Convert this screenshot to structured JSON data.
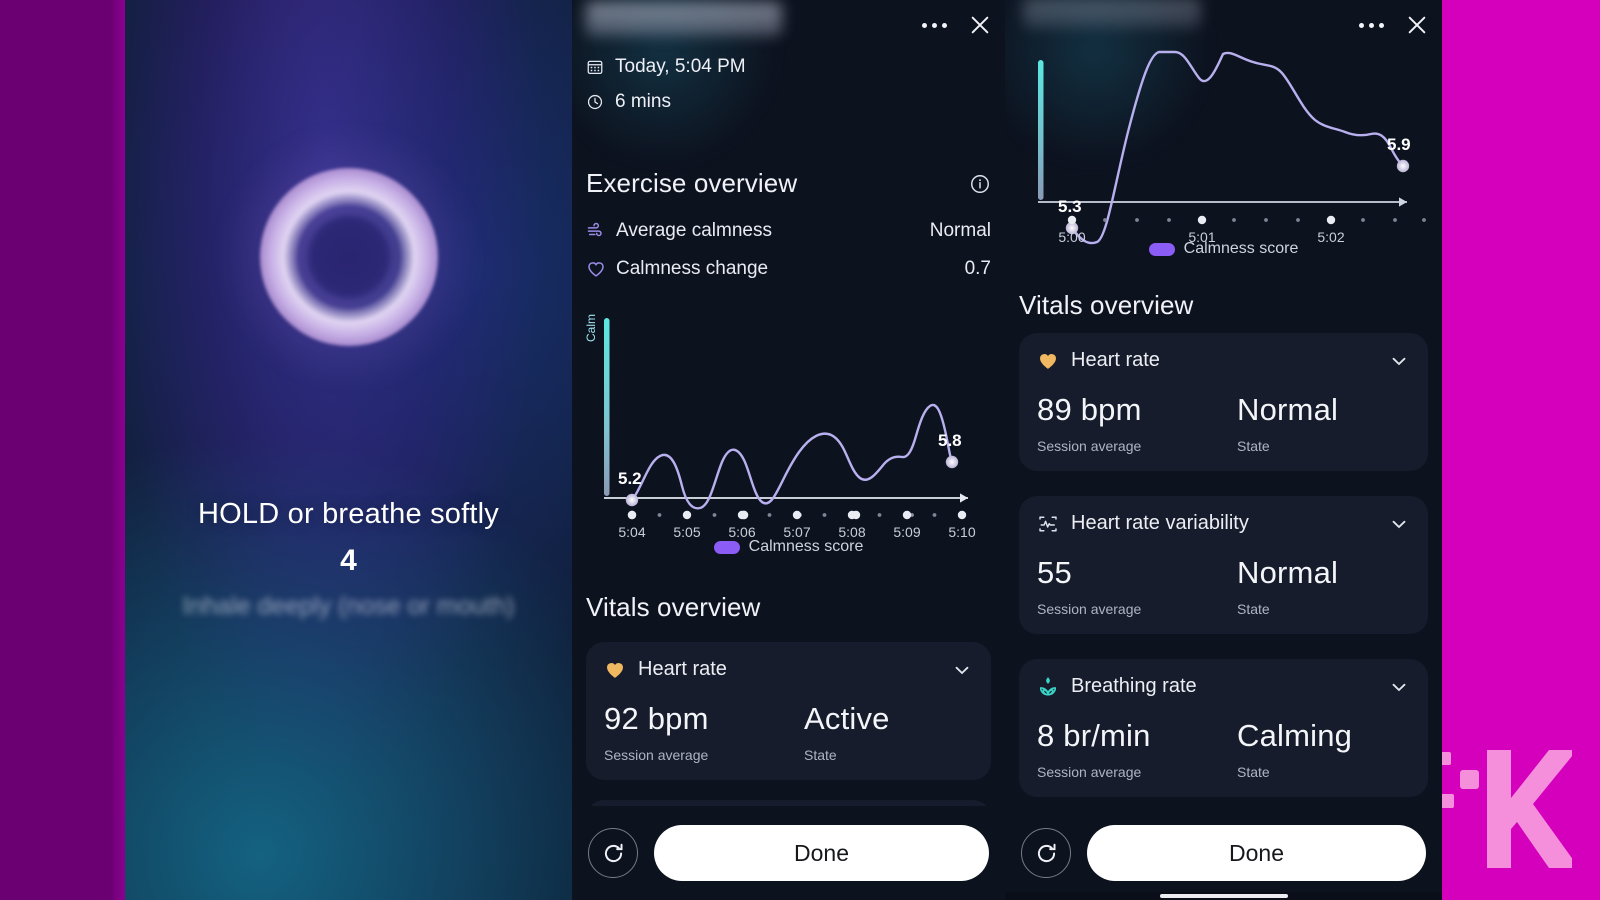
{
  "backdrop": {
    "left_band_color": "#6b0072",
    "right_color": "#d400bc",
    "watermark": "K"
  },
  "breathing_panel": {
    "name": "breathing-exercise",
    "instruction": "HOLD or breathe softly",
    "count": "4",
    "sub_instruction": "Inhale deeply (nose or mouth)",
    "ring_icon": "breathing-ring"
  },
  "middle_panel": {
    "header": {
      "title_redacted": "",
      "more_icon": "more-options-icon",
      "close_icon": "close-icon"
    },
    "meta": [
      {
        "icon": "calendar-icon",
        "text": "Today, 5:04 PM"
      },
      {
        "icon": "clock-icon",
        "text": "6 mins"
      }
    ],
    "exercise_overview": {
      "title": "Exercise overview",
      "info_icon": "info-icon",
      "rows": [
        {
          "icon": "wind-icon",
          "label": "Average calmness",
          "value": "Normal"
        },
        {
          "icon": "heart-outline-icon",
          "label": "Calmness change",
          "value": "0.7"
        }
      ]
    },
    "vitals_overview": {
      "title": "Vitals overview",
      "cards": [
        {
          "icon": "heart-filled-icon",
          "name": "Heart rate",
          "chevron": "chevron-down-icon",
          "value": "92 bpm",
          "value_label": "Session average",
          "state": "Active",
          "state_label": "State"
        }
      ]
    },
    "footer": {
      "refresh_icon": "refresh-icon",
      "done_label": "Done"
    }
  },
  "right_panel": {
    "header": {
      "title_redacted": "",
      "more_icon": "more-options-icon",
      "close_icon": "close-icon"
    },
    "vitals_overview": {
      "title": "Vitals overview",
      "cards": [
        {
          "icon": "heart-filled-icon",
          "name": "Heart rate",
          "chevron": "chevron-down-icon",
          "value": "89 bpm",
          "value_label": "Session average",
          "state": "Normal",
          "state_label": "State"
        },
        {
          "icon": "heart-rate-variability-icon",
          "name": "Heart rate variability",
          "chevron": "chevron-down-icon",
          "value": "55",
          "value_label": "Session average",
          "state": "Normal",
          "state_label": "State"
        },
        {
          "icon": "breathing-leaf-icon",
          "name": "Breathing rate",
          "chevron": "chevron-down-icon",
          "value": "8 br/min",
          "value_label": "Session average",
          "state": "Calming",
          "state_label": "State"
        }
      ]
    },
    "footer": {
      "refresh_icon": "refresh-icon",
      "done_label": "Done"
    }
  },
  "chart_data": [
    {
      "id": "calmness-chart-middle",
      "type": "line",
      "title": "",
      "xlabel": "",
      "ylabel": "Calm",
      "legend": [
        "Calmness score"
      ],
      "legend_position": "bottom-center",
      "grid": false,
      "line_color": "#b8b0ee",
      "axis_gradient": [
        "#5be8e0",
        "#8b9ab5"
      ],
      "xticks": [
        "5:04",
        "5:05",
        "5:06",
        "5:07",
        "5:08",
        "5:09",
        "5:10"
      ],
      "xlim": [
        "5:04",
        "5:10"
      ],
      "ylim": [
        4.8,
        6.4
      ],
      "start_point": {
        "x": "5:04",
        "y": 5.2,
        "label": "5.2"
      },
      "end_point": {
        "x": "5:10",
        "y": 5.8,
        "label": "5.8"
      },
      "x": [
        5.04,
        5.05,
        5.06,
        5.07,
        5.08,
        5.09,
        5.1
      ],
      "values": [
        5.2,
        5.5,
        5.5,
        5.7,
        5.5,
        5.9,
        5.8
      ],
      "series": [
        {
          "name": "Calmness score",
          "values": [
            5.2,
            5.45,
            5.58,
            5.28,
            5.6,
            5.26,
            5.72,
            5.76,
            5.47,
            5.66,
            5.78,
            6.0,
            5.8
          ]
        }
      ]
    },
    {
      "id": "calmness-chart-right",
      "type": "line",
      "title": "",
      "xlabel": "",
      "ylabel": "",
      "legend": [
        "Calmness score"
      ],
      "legend_position": "bottom-center",
      "grid": false,
      "line_color": "#b8b0ee",
      "axis_gradient": [
        "#5be8e0",
        "#8b9ab5"
      ],
      "xticks": [
        "5:00",
        "5:01",
        "5:02"
      ],
      "xlim": [
        "5:00",
        "5:03"
      ],
      "ylim": [
        5.0,
        6.6
      ],
      "start_point": {
        "x": "5:00",
        "y": 5.3,
        "label": "5.3"
      },
      "end_point": {
        "x": "5:02",
        "y": 5.9,
        "label": "5.9"
      },
      "x": [
        5.0,
        5.01,
        5.02
      ],
      "values": [
        5.3,
        6.4,
        5.9
      ],
      "series": [
        {
          "name": "Calmness score",
          "values": [
            5.3,
            5.22,
            6.5,
            6.55,
            6.3,
            6.45,
            6.4,
            6.3,
            6.12,
            6.02,
            5.98,
            5.96,
            5.9
          ]
        }
      ]
    }
  ]
}
